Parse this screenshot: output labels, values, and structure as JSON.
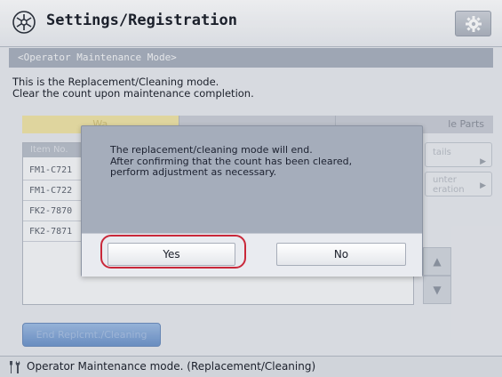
{
  "header": {
    "title": "Settings/Registration",
    "icon": "settings-registration-icon",
    "gear_button_icon": "gear-icon"
  },
  "subtitle": "<Operator Maintenance Mode>",
  "description": {
    "line1": "This is the Replacement/Cleaning mode.",
    "line2": "Clear the count upon maintenance completion."
  },
  "tabs": {
    "first_visible": "Wa",
    "last_visible": "le Parts"
  },
  "list": {
    "header": "Item No.",
    "rows": [
      "FM1-C721",
      "FM1-C722",
      "FK2-7870",
      "FK2-7871"
    ]
  },
  "side_buttons": {
    "details": "tails",
    "counter_line1": "unter",
    "counter_line2": "eration"
  },
  "end_button": "End Replcmt./Cleaning",
  "dialog": {
    "line1": "The replacement/cleaning mode will end.",
    "line2": "After confirming that the count has been cleared,",
    "line3": "perform adjustment as necessary.",
    "yes_label": "Yes",
    "no_label": "No"
  },
  "status_bar": {
    "icon": "wrench-screwdriver-icon",
    "text": "Operator Maintenance mode. (Replacement/Cleaning)"
  },
  "colors": {
    "highlight_ring": "#c9283a",
    "dialog_bg": "#a5adbb",
    "active_tab": "#efe3a6"
  }
}
